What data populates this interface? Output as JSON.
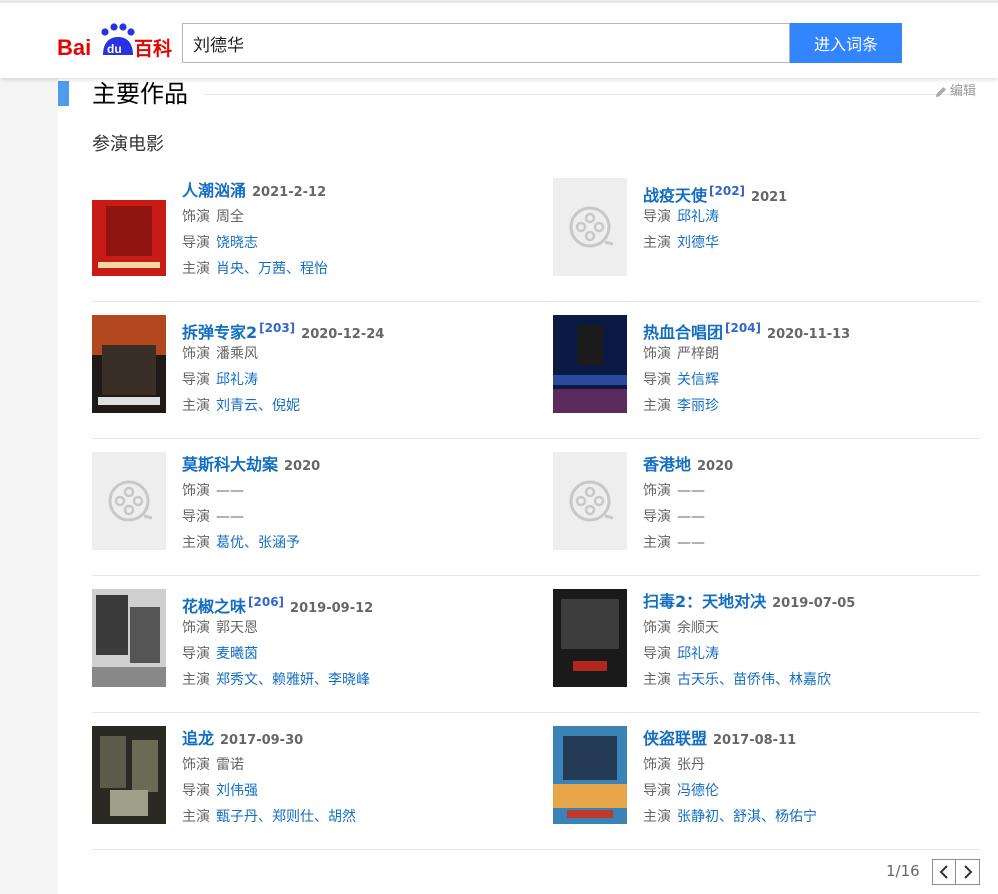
{
  "header": {
    "logo_text": "Bai du 百科",
    "search_value": "刘德华",
    "search_button": "进入词条"
  },
  "section": {
    "title": "主要作品",
    "edit_label": "编辑",
    "subtitle": "参演电影"
  },
  "labels": {
    "role": "饰演",
    "director": "导演",
    "cast": "主演"
  },
  "films": [
    {
      "name": "人潮汹涌",
      "ref": "",
      "date": "2021-2-12",
      "role": "周全",
      "director": "饶晓志",
      "cast": "肖央、万茜、程怡",
      "poster": "red"
    },
    {
      "name": "战疫天使",
      "ref": "[202]",
      "date": "2021",
      "role": "",
      "director": "邱礼涛",
      "cast": "刘德华",
      "poster": "placeholder"
    },
    {
      "name": "拆弹专家2",
      "ref": "[203]",
      "date": "2020-12-24",
      "role": "潘乘风",
      "director": "邱礼涛",
      "cast": "刘青云、倪妮",
      "poster": "fire"
    },
    {
      "name": "热血合唱团",
      "ref": "[204]",
      "date": "2020-11-13",
      "role": "严梓朗",
      "director": "关信辉",
      "cast": "李丽珍",
      "poster": "choir"
    },
    {
      "name": "莫斯科大劫案",
      "ref": "",
      "date": "2020",
      "role": "——",
      "director": "——",
      "cast": "葛优、张涵予",
      "poster": "placeholder"
    },
    {
      "name": "香港地",
      "ref": "",
      "date": "2020",
      "role": "——",
      "director": "——",
      "cast": "——",
      "poster": "placeholder"
    },
    {
      "name": "花椒之味",
      "ref": "[206]",
      "date": "2019-09-12",
      "role": "郭天恩",
      "director": "麦曦茵",
      "cast": "郑秀文、赖雅妍、李晓峰",
      "poster": "pepper"
    },
    {
      "name": "扫毒2：天地对决",
      "ref": "",
      "date": "2019-07-05",
      "role": "余顺天",
      "director": "邱礼涛",
      "cast": "古天乐、苗侨伟、林嘉欣",
      "poster": "dark"
    },
    {
      "name": "追龙",
      "ref": "",
      "date": "2017-09-30",
      "role": "雷诺",
      "director": "刘伟强",
      "cast": "甄子丹、郑则仕、胡然",
      "poster": "dragon"
    },
    {
      "name": "侠盗联盟",
      "ref": "",
      "date": "2017-08-11",
      "role": "张丹",
      "director": "冯德伦",
      "cast": "张静初、舒淇、杨佑宁",
      "poster": "blue"
    }
  ],
  "pager": {
    "text": "1/16"
  },
  "colors": {
    "accent": "#3385ff",
    "link": "#136ec2",
    "section_bar": "#4f9cee"
  }
}
